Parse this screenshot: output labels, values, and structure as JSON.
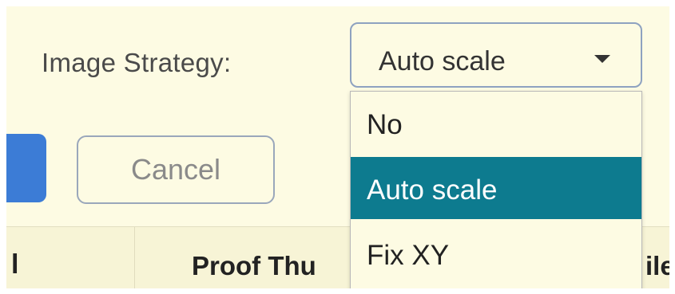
{
  "form": {
    "image_strategy_label": "Image Strategy:",
    "select_value": "Auto scale",
    "options": [
      "No",
      "Auto scale",
      "Fix XY"
    ],
    "selected_option": "Auto scale",
    "cancel_label": "Cancel"
  },
  "table": {
    "columns": [
      "l",
      "Proof Thu",
      "ile"
    ]
  },
  "colors": {
    "background": "#fdfbe3",
    "selected_highlight": "#0d7b8f",
    "primary_button": "#3c7cd6"
  }
}
